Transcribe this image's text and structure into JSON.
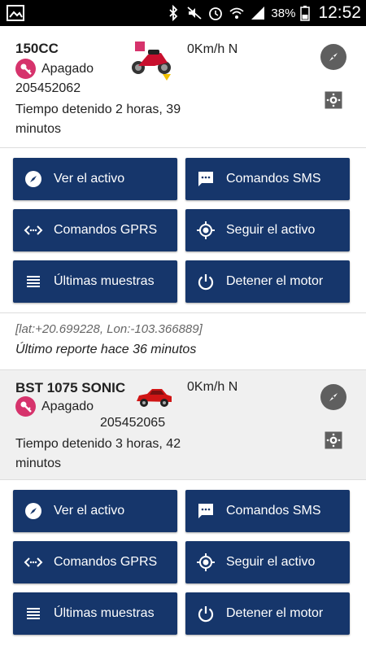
{
  "status_bar": {
    "battery_percent": "38%",
    "time": "12:52"
  },
  "assets": [
    {
      "name": "150CC",
      "state": "Apagado",
      "device_id": "205452062",
      "stopped_time": "Tiempo detenido 2 horas, 39 minutos",
      "speed": "0Km/h N",
      "vehicle_icon": "motorcycle-icon",
      "buttons": {
        "view": "Ver el activo",
        "sms": "Comandos SMS",
        "gprs": "Comandos GPRS",
        "follow": "Seguir el activo",
        "samples": "Últimas muestras",
        "stop_engine": "Detener el motor"
      },
      "coords": "[lat:+20.699228, Lon:-103.366889]",
      "last_report": "Último reporte hace 36 minutos"
    },
    {
      "name": "BST 1075 SONIC",
      "state": "Apagado",
      "device_id": "205452065",
      "stopped_time": "Tiempo detenido 3 horas, 42 minutos",
      "speed": "0Km/h N",
      "vehicle_icon": "car-icon",
      "buttons": {
        "view": "Ver el activo",
        "sms": "Comandos SMS",
        "gprs": "Comandos GPRS",
        "follow": "Seguir el activo",
        "samples": "Últimas muestras",
        "stop_engine": "Detener el motor"
      }
    }
  ],
  "colors": {
    "button_bg": "#16366b",
    "key_badge": "#d6336c",
    "icon_gray": "#5f5f5f"
  }
}
